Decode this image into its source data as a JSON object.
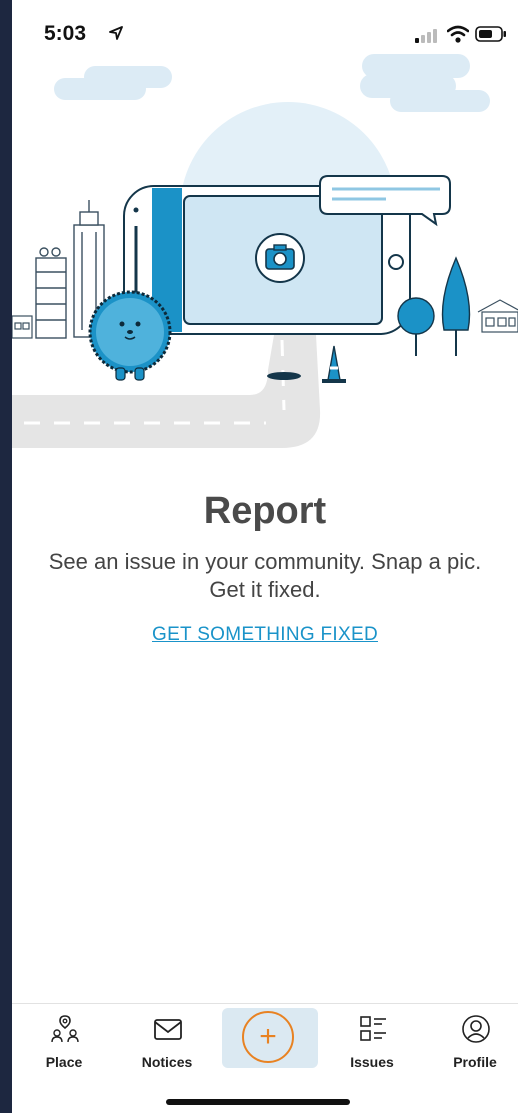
{
  "status": {
    "time": "5:03"
  },
  "main": {
    "title": "Report",
    "description": "See an issue in your community. Snap a pic. Get it fixed.",
    "cta_label": "GET SOMETHING FIXED"
  },
  "tabbar": {
    "items": [
      {
        "label": "Place",
        "icon": "place-icon"
      },
      {
        "label": "Notices",
        "icon": "envelope-icon"
      },
      {
        "label": "+",
        "icon": "plus-icon"
      },
      {
        "label": "Issues",
        "icon": "list-icon"
      },
      {
        "label": "Profile",
        "icon": "person-icon"
      }
    ]
  },
  "colors": {
    "accent": "#1a93c9",
    "add_button": "#e88222",
    "add_tab_bg": "#dbe9f2"
  }
}
